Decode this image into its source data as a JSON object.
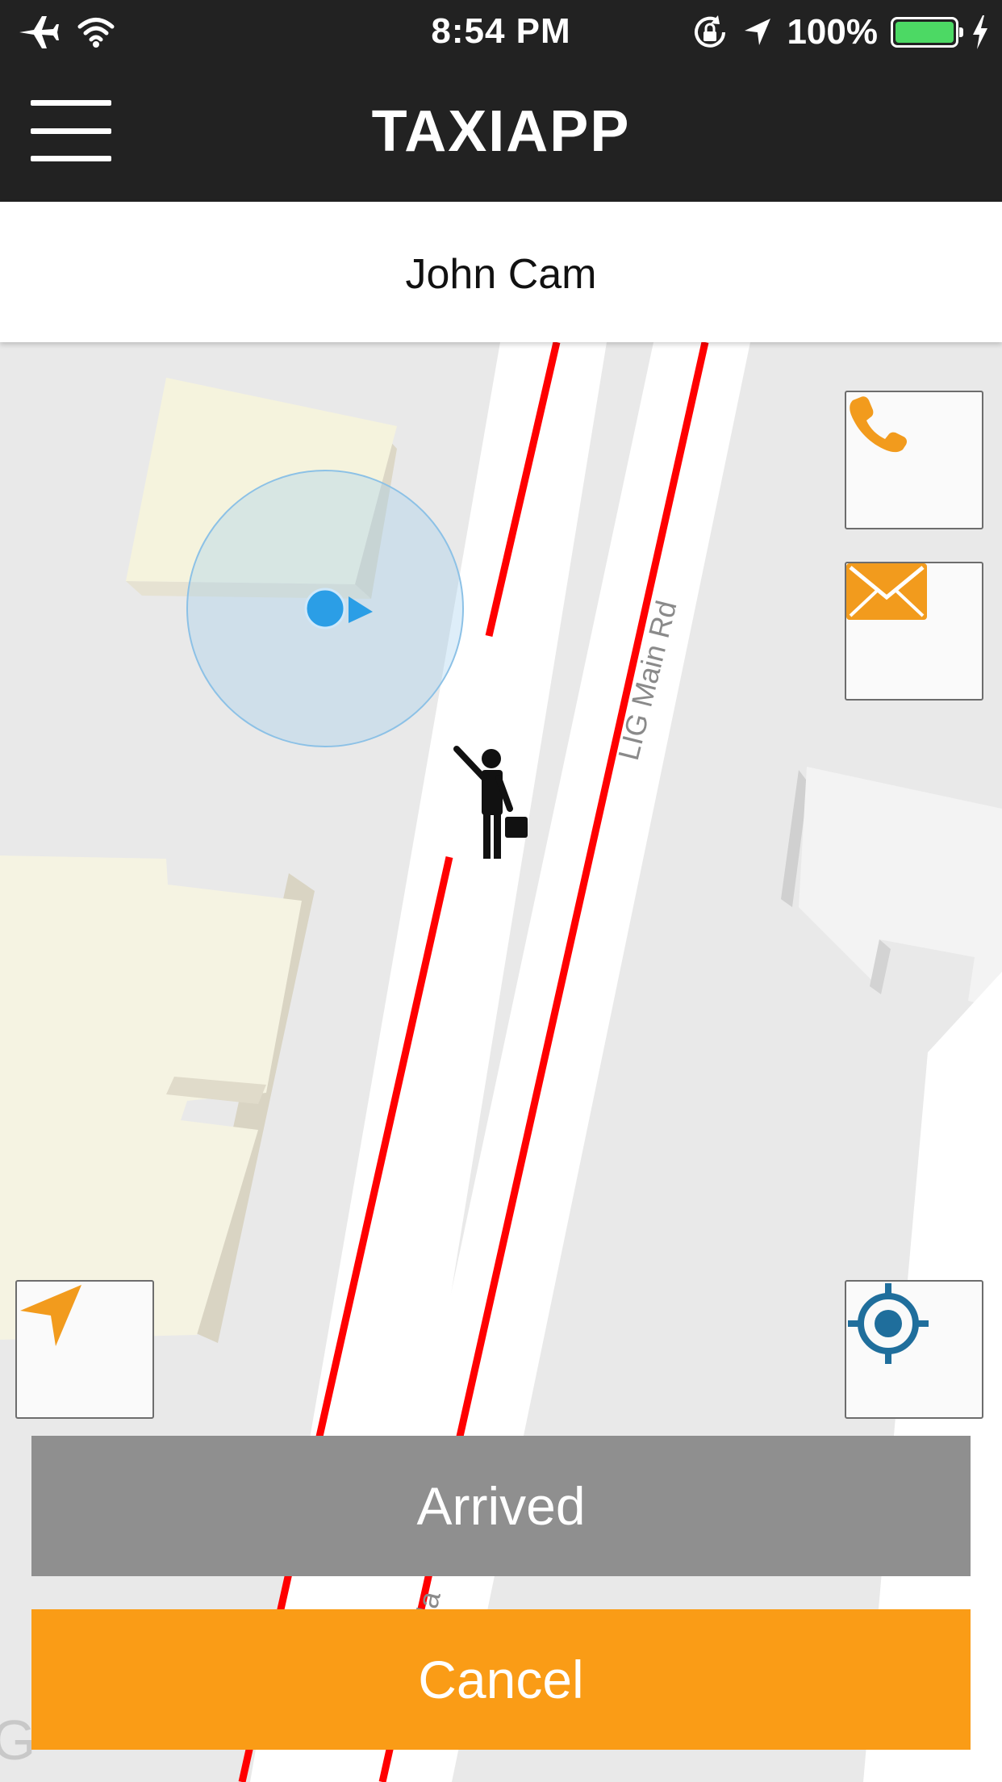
{
  "status_bar": {
    "time": "8:54 PM",
    "battery_percent": "100%",
    "battery_level": 1.0,
    "icons": [
      "airplane-icon",
      "wifi-icon",
      "rotation-lock-icon",
      "location-arrow-icon",
      "battery-icon",
      "charging-bolt-icon"
    ]
  },
  "header": {
    "app_title": "TAXIAPP",
    "menu_icon": "hamburger-menu-icon"
  },
  "passenger": {
    "name": "John Cam"
  },
  "map": {
    "street_label": "LIG Main Rd",
    "street_label_partial": "Ma",
    "watermark": "G",
    "route_color": "#ff0000",
    "user_location_color": "#2b9ee6",
    "passenger_marker": "hailing-passenger-icon"
  },
  "controls": {
    "call_icon": "phone-icon",
    "message_icon": "mail-icon",
    "navigate_icon": "navigation-arrow-icon",
    "locate_icon": "my-location-icon"
  },
  "actions": {
    "arrived_label": "Arrived",
    "cancel_label": "Cancel"
  },
  "colors": {
    "header_bg": "#222222",
    "accent": "#fa9c16",
    "arrived_bg": "#8f8f8f",
    "locate_icon": "#1f6e9c"
  }
}
